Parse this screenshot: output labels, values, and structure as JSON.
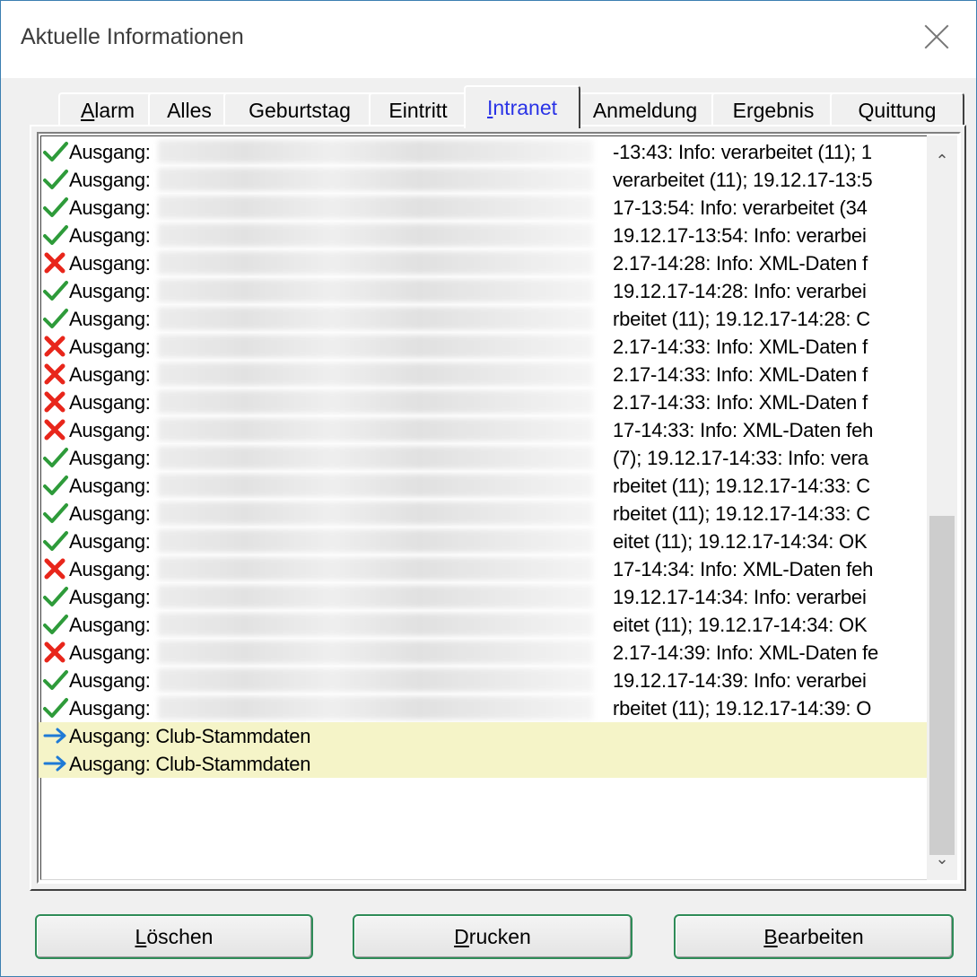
{
  "window": {
    "title": "Aktuelle Informationen"
  },
  "tabs": [
    {
      "label_first": "A",
      "label_rest": "larm"
    },
    {
      "label_first": "",
      "label_rest": "Alles"
    },
    {
      "label_first": "",
      "label_rest": "Geburtstag"
    },
    {
      "label_first": "",
      "label_rest": "Eintritt"
    },
    {
      "label_first": "I",
      "label_rest": "ntranet"
    },
    {
      "label_first": "",
      "label_rest": "Anmeldung"
    },
    {
      "label_first": "",
      "label_rest": "Ergebnis"
    },
    {
      "label_first": "",
      "label_rest": "Quittung"
    }
  ],
  "active_tab": "Intranet",
  "list": {
    "rows": [
      {
        "status": "ok",
        "label": "Ausgang:",
        "tail": "-13:43: Info: verarbeitet (11); 1"
      },
      {
        "status": "ok",
        "label": "Ausgang:",
        "tail": "verarbeitet (11); 19.12.17-13:5"
      },
      {
        "status": "ok",
        "label": "Ausgang:",
        "tail": "17-13:54: Info: verarbeitet (34"
      },
      {
        "status": "ok",
        "label": "Ausgang:",
        "tail": "19.12.17-13:54: Info: verarbei"
      },
      {
        "status": "error",
        "label": "Ausgang:",
        "tail": "2.17-14:28: Info: XML-Daten f"
      },
      {
        "status": "ok",
        "label": "Ausgang:",
        "tail": "19.12.17-14:28: Info: verarbei"
      },
      {
        "status": "ok",
        "label": "Ausgang:",
        "tail": "rbeitet (11); 19.12.17-14:28: C"
      },
      {
        "status": "error",
        "label": "Ausgang:",
        "tail": "2.17-14:33: Info: XML-Daten f"
      },
      {
        "status": "error",
        "label": "Ausgang:",
        "tail": "2.17-14:33: Info: XML-Daten f"
      },
      {
        "status": "error",
        "label": "Ausgang:",
        "tail": "2.17-14:33: Info: XML-Daten f"
      },
      {
        "status": "error",
        "label": "Ausgang:",
        "tail": "17-14:33: Info: XML-Daten feh"
      },
      {
        "status": "ok",
        "label": "Ausgang:",
        "tail": "(7); 19.12.17-14:33: Info: vera"
      },
      {
        "status": "ok",
        "label": "Ausgang:",
        "tail": "rbeitet (11); 19.12.17-14:33: C"
      },
      {
        "status": "ok",
        "label": "Ausgang:",
        "tail": "rbeitet (11); 19.12.17-14:33: C"
      },
      {
        "status": "ok",
        "label": "Ausgang:",
        "tail": "eitet (11); 19.12.17-14:34: OK"
      },
      {
        "status": "error",
        "label": "Ausgang:",
        "tail": "17-14:34: Info: XML-Daten feh"
      },
      {
        "status": "ok",
        "label": "Ausgang:",
        "tail": "19.12.17-14:34: Info: verarbei"
      },
      {
        "status": "ok",
        "label": "Ausgang:",
        "tail": "eitet (11); 19.12.17-14:34: OK"
      },
      {
        "status": "error",
        "label": "Ausgang:",
        "tail": "2.17-14:39: Info: XML-Daten fe"
      },
      {
        "status": "ok",
        "label": "Ausgang:",
        "tail": "19.12.17-14:39: Info: verarbei"
      },
      {
        "status": "ok",
        "label": "Ausgang:",
        "tail": "rbeitet (11); 19.12.17-14:39: O"
      },
      {
        "status": "pending",
        "label": "Ausgang: Club-Stammdaten",
        "tail": ""
      },
      {
        "status": "pending",
        "label": "Ausgang: Club-Stammdaten",
        "tail": ""
      }
    ]
  },
  "buttons": {
    "delete": {
      "first": "L",
      "rest": "öschen"
    },
    "print": {
      "first": "D",
      "rest": "rucken"
    },
    "edit": {
      "first": "B",
      "rest": "earbeiten"
    }
  },
  "colors": {
    "ok": "#2e9b3a",
    "error": "#e8261b",
    "pending": "#1e7ad6",
    "active_tab": "#2a33e6",
    "highlight_row": "#f5f4c8"
  },
  "icons": {
    "ok": "checkmark-icon",
    "error": "cross-icon",
    "pending": "arrow-right-icon"
  }
}
